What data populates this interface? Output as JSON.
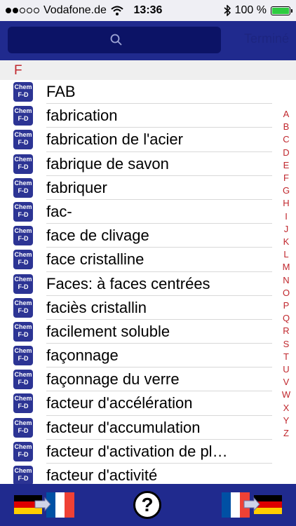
{
  "status": {
    "carrier": "Vodafone.de",
    "time": "13:36",
    "battery": "100 %",
    "signal_bars_filled": 2,
    "signal_bars_total": 5
  },
  "header": {
    "search_placeholder": "",
    "done_label": "Terminé"
  },
  "list": {
    "section_letter": "F",
    "icon_text_top": "Chem",
    "icon_text_bottom": "F-D",
    "items": [
      {
        "label": "FAB"
      },
      {
        "label": "fabrication"
      },
      {
        "label": "fabrication de l'acier"
      },
      {
        "label": "fabrique de savon"
      },
      {
        "label": "fabriquer"
      },
      {
        "label": "fac-"
      },
      {
        "label": "face de clivage"
      },
      {
        "label": "face cristalline"
      },
      {
        "label": "Faces: à faces centrées"
      },
      {
        "label": "faciès cristallin"
      },
      {
        "label": "facilement soluble"
      },
      {
        "label": "façonnage"
      },
      {
        "label": "façonnage du verre"
      },
      {
        "label": "facteur d'accélération"
      },
      {
        "label": "facteur d'accumulation"
      },
      {
        "label": "facteur d'activation de pl…"
      },
      {
        "label": "facteur d'activité"
      }
    ]
  },
  "index": [
    "A",
    "B",
    "C",
    "D",
    "E",
    "F",
    "G",
    "H",
    "I",
    "J",
    "K",
    "L",
    "M",
    "N",
    "O",
    "P",
    "Q",
    "R",
    "S",
    "T",
    "U",
    "V",
    "W",
    "X",
    "Y",
    "Z"
  ],
  "colors": {
    "header_bg": "#202a8e",
    "accent_red": "#c0272d"
  },
  "toolbar": {
    "help_label": "?"
  }
}
